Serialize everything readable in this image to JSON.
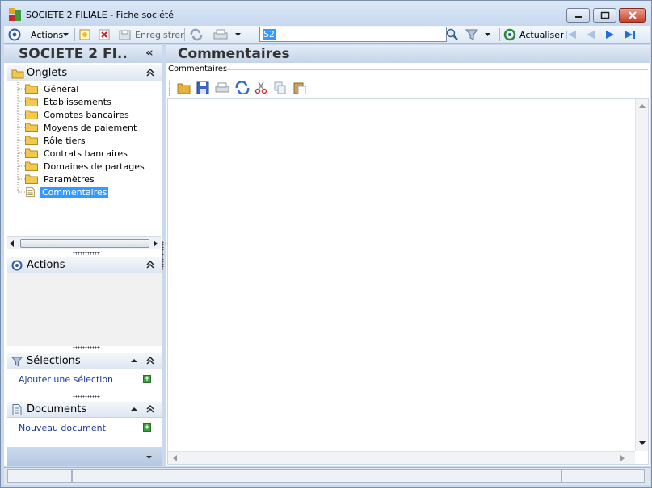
{
  "window": {
    "title": "SOCIETE 2 FILIALE -  Fiche société"
  },
  "toolbar": {
    "actions_label": "Actions",
    "save_label": "Enregistrer",
    "search_value": "S2",
    "refresh_label": "Actualiser"
  },
  "left": {
    "header": "SOCIETE 2 FI..",
    "collapse_glyph": "«",
    "onglets": {
      "label": "Onglets",
      "items": [
        "Général",
        "Etablissements",
        "Comptes bancaires",
        "Moyens de paiement",
        "Rôle tiers",
        "Contrats bancaires",
        "Domaines de partages",
        "Paramètres",
        "Commentaires"
      ],
      "selected_index": 8
    },
    "actions": {
      "label": "Actions"
    },
    "selections": {
      "label": "Sélections",
      "link": "Ajouter une sélection"
    },
    "documents": {
      "label": "Documents",
      "link": "Nouveau document"
    }
  },
  "main": {
    "title": "Commentaires",
    "group_label": "Commentaires"
  },
  "icons": [
    "app-icon",
    "minimize-icon",
    "maximize-icon",
    "close-icon",
    "actions-icon",
    "save-icon",
    "delete-icon",
    "print-icon",
    "refresh-icon",
    "search-icon",
    "filter-icon",
    "actualiser-icon",
    "first-icon",
    "prev-icon",
    "next-icon",
    "last-icon",
    "folder-icon",
    "document-icon",
    "open-icon",
    "cut-icon",
    "copy-icon",
    "paste-icon"
  ]
}
